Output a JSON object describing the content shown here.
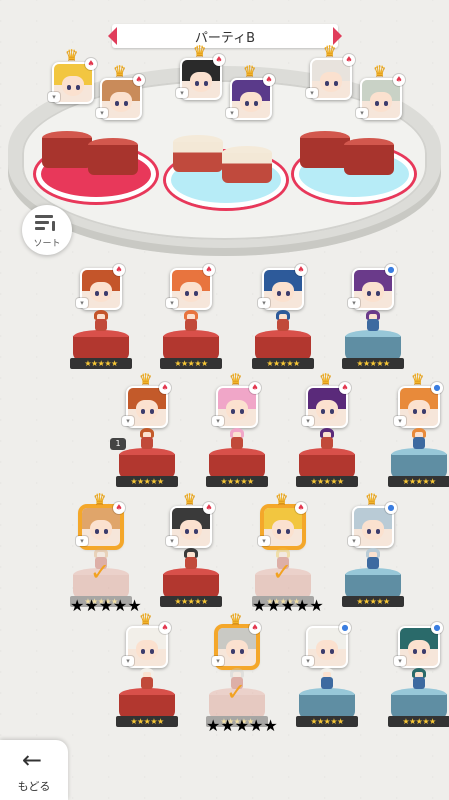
{
  "header": {
    "title": "パーティB"
  },
  "sort_button": {
    "label": "ソート",
    "icon": "sort-icon"
  },
  "back_button": {
    "label": "もどる",
    "icon": "back-arrow-icon"
  },
  "stars": "★★★★★",
  "check_symbol": "✓",
  "crown_symbol": "♛",
  "party_slots": [
    {
      "slot": 1,
      "pad": "red",
      "leader": {
        "name": "portrait",
        "hair": "#f2c640",
        "crown": true,
        "element": "fire"
      },
      "member": {
        "hair": "#c98b5a",
        "crown": true,
        "element": "fire"
      }
    },
    {
      "slot": 2,
      "pad": "blue",
      "leader": {
        "hair": "#2a2a2a",
        "crown": true,
        "element": "fire"
      },
      "member": {
        "hair": "#5a3a8a",
        "crown": true,
        "element": "fire"
      }
    },
    {
      "slot": 3,
      "pad": "blue",
      "leader": {
        "hair": "#e8e3dd",
        "crown": true,
        "element": "fire"
      },
      "member": {
        "hair": "#c9d2c6",
        "crown": true,
        "element": "fire"
      }
    }
  ],
  "roster": [
    {
      "hair": "#c4552a",
      "element": "fire",
      "crown": false,
      "pedestal": "red",
      "state": "normal"
    },
    {
      "hair": "#e8743e",
      "element": "fire",
      "crown": false,
      "pedestal": "red",
      "state": "normal"
    },
    {
      "hair": "#2d5a9a",
      "element": "fire",
      "crown": false,
      "pedestal": "red",
      "state": "normal"
    },
    {
      "hair": "#6a3a8a",
      "element": "water",
      "crown": false,
      "pedestal": "blue",
      "state": "normal"
    },
    {
      "hair": "#c35a2a",
      "element": "fire",
      "crown": true,
      "pedestal": "red",
      "state": "normal",
      "count_badge": "1"
    },
    {
      "hair": "#f0a6c8",
      "element": "fire",
      "crown": true,
      "pedestal": "red",
      "state": "normal"
    },
    {
      "hair": "#5a2a7a",
      "element": "fire",
      "crown": true,
      "pedestal": "red",
      "state": "normal"
    },
    {
      "hair": "#e88a3a",
      "element": "water",
      "crown": true,
      "pedestal": "blue",
      "state": "normal"
    },
    {
      "hair": "#e0a56a",
      "element": "fire",
      "crown": true,
      "pedestal": "ghost",
      "state": "selected"
    },
    {
      "hair": "#3a3a3a",
      "element": "fire",
      "crown": true,
      "pedestal": "red",
      "state": "normal"
    },
    {
      "hair": "#f2c640",
      "element": "fire",
      "crown": true,
      "pedestal": "ghost",
      "state": "selected"
    },
    {
      "hair": "#b9cbd6",
      "element": "water",
      "crown": true,
      "pedestal": "blue",
      "state": "normal"
    },
    {
      "hair": "#f2efe9",
      "element": "fire",
      "crown": true,
      "pedestal": "red",
      "state": "normal"
    },
    {
      "hair": "#c9c9c4",
      "element": "fire",
      "crown": true,
      "pedestal": "ghost",
      "state": "selected"
    },
    {
      "hair": "#f0efea",
      "element": "water",
      "crown": false,
      "pedestal": "blue",
      "state": "normal"
    },
    {
      "hair": "#2a6a6a",
      "element": "water",
      "crown": false,
      "pedestal": "blue",
      "state": "normal"
    }
  ]
}
